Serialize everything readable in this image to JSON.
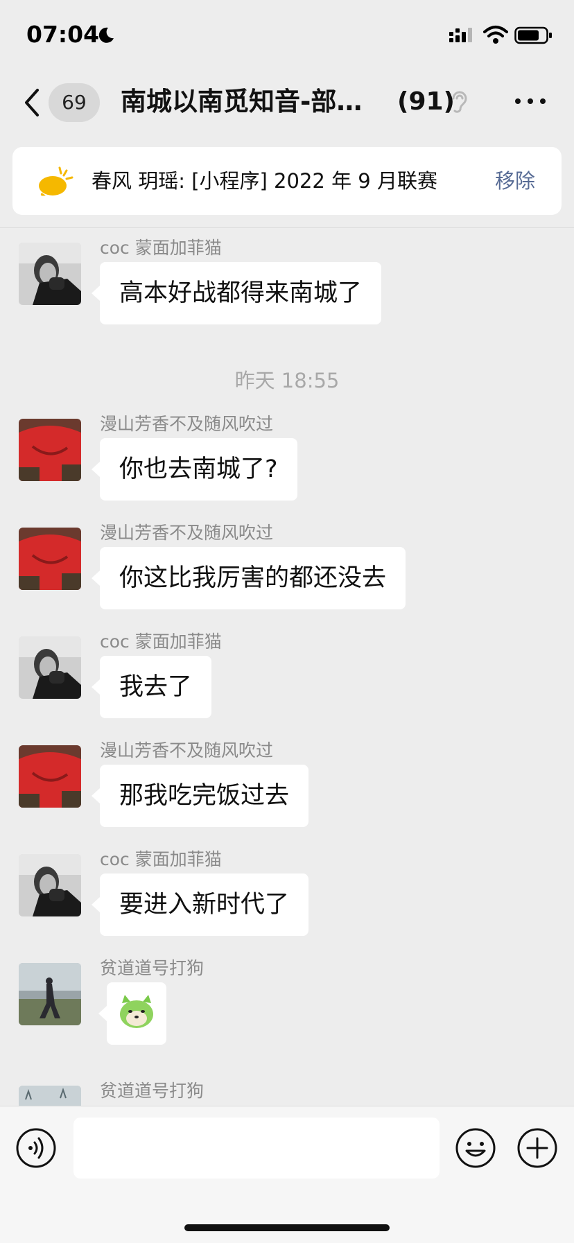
{
  "status_bar": {
    "time": "07:04"
  },
  "header": {
    "unread_count": "69",
    "title": "南城以南觅知音-部…",
    "member_count": "(91)"
  },
  "pinned": {
    "text": "春风 玥瑶: [小程序] 2022 年 9 月联赛",
    "remove_label": "移除"
  },
  "messages": [
    {
      "type": "text",
      "sender": "coc 蒙面加菲猫",
      "avatar": "avatar-coc",
      "text": "高本好战都得来南城了"
    },
    {
      "type": "timestamp",
      "text": "昨天 18:55"
    },
    {
      "type": "text",
      "sender": "漫山芳香不及随风吹过",
      "avatar": "avatar-red",
      "text": "你也去南城了?"
    },
    {
      "type": "text",
      "sender": "漫山芳香不及随风吹过",
      "avatar": "avatar-red",
      "text": "你这比我厉害的都还没去"
    },
    {
      "type": "text",
      "sender": "coc 蒙面加菲猫",
      "avatar": "avatar-coc",
      "text": "我去了"
    },
    {
      "type": "text",
      "sender": "漫山芳香不及随风吹过",
      "avatar": "avatar-red",
      "text": "那我吃完饭过去"
    },
    {
      "type": "text",
      "sender": "coc 蒙面加菲猫",
      "avatar": "avatar-coc",
      "text": "要进入新时代了"
    },
    {
      "type": "sticker",
      "sender": "贫道道号打狗",
      "avatar": "avatar-field",
      "sticker": "green-dog-sticker"
    },
    {
      "type": "partial",
      "sender": "贫道道号打狗",
      "avatar": "avatar-field"
    }
  ],
  "input": {
    "placeholder": ""
  },
  "colors": {
    "background": "#ededed",
    "bubble": "#ffffff",
    "link": "#576b95",
    "meta": "#8a8a8a"
  }
}
